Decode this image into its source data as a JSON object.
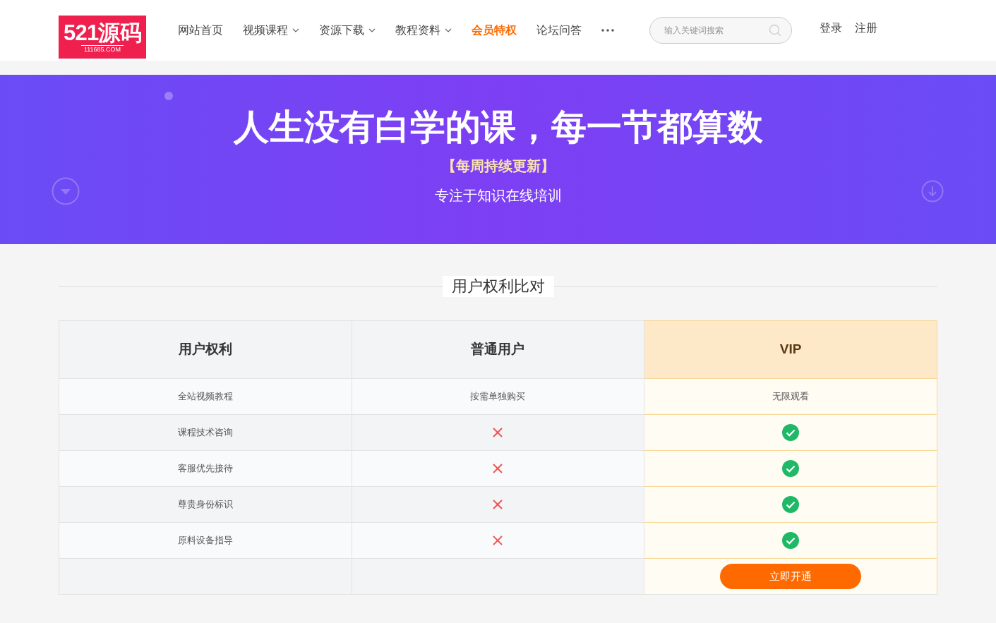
{
  "header": {
    "logo": {
      "mark": "521源码",
      "domain": "111685.COM"
    },
    "nav": [
      {
        "label": "网站首页",
        "dropdown": false,
        "selected": false
      },
      {
        "label": "视频课程",
        "dropdown": true,
        "selected": false
      },
      {
        "label": "资源下载",
        "dropdown": true,
        "selected": false
      },
      {
        "label": "教程资料",
        "dropdown": true,
        "selected": false
      },
      {
        "label": "会员特权",
        "dropdown": false,
        "selected": true
      },
      {
        "label": "论坛问答",
        "dropdown": false,
        "selected": false
      }
    ],
    "search": {
      "placeholder": "输入关键词搜索"
    },
    "account": [
      "登录",
      "注册"
    ]
  },
  "banner": {
    "title": "人生没有白学的课，每一节都算数",
    "tagline": "【每周持续更新】",
    "subtitle": "专注于知识在线培训"
  },
  "comparison": {
    "heading": "用户权利比对",
    "columns": [
      "用户权利",
      "普通用户",
      "VIP"
    ],
    "rows": [
      {
        "cells": [
          {
            "kind": "text",
            "text": "全站视频教程"
          },
          {
            "kind": "text",
            "text": "按需单独购买"
          },
          {
            "kind": "text",
            "text": "无限观看"
          }
        ]
      },
      {
        "cells": [
          {
            "kind": "text",
            "text": "课程技术咨询"
          },
          {
            "kind": "cross"
          },
          {
            "kind": "check"
          }
        ]
      },
      {
        "cells": [
          {
            "kind": "text",
            "text": "客服优先接待"
          },
          {
            "kind": "cross"
          },
          {
            "kind": "check"
          }
        ]
      },
      {
        "cells": [
          {
            "kind": "text",
            "text": "尊贵身份标识"
          },
          {
            "kind": "cross"
          },
          {
            "kind": "check"
          }
        ]
      },
      {
        "cells": [
          {
            "kind": "text",
            "text": "原料设备指导"
          },
          {
            "kind": "cross"
          },
          {
            "kind": "check"
          }
        ]
      },
      {
        "cells": [
          {
            "kind": "empty"
          },
          {
            "kind": "empty"
          },
          {
            "kind": "button",
            "text": "立即开通"
          }
        ]
      }
    ]
  }
}
